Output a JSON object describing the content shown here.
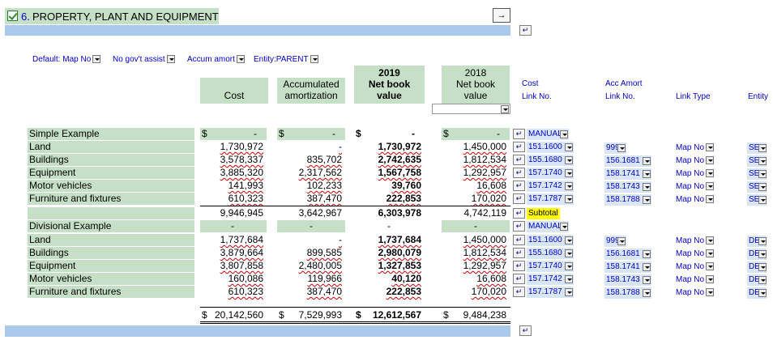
{
  "header": {
    "number": "6.",
    "title": "PROPERTY, PLANT AND EQUIPMENT"
  },
  "filters": {
    "map": "Default: Map No",
    "govt": "No gov't assist",
    "amort": "Accum amort",
    "entity": "Entity:PARENT"
  },
  "columns": {
    "cost": "Cost",
    "accum_line1": "Accumulated",
    "accum_line2": "amortization",
    "nbv2019_year": "2019",
    "nbv2019_l2": "Net book",
    "nbv2019_l3": "value",
    "nbv2018_year": "2018",
    "nbv2018_l2": "Net book",
    "nbv2018_l3": "value",
    "cost_link_1": "Cost",
    "cost_link_2": "Link No.",
    "acc_link_1": "Acc Amort",
    "acc_link_2": "Link No.",
    "link_type": "Link Type",
    "entity": "Entity"
  },
  "simple": {
    "heading": "Simple Example",
    "heading_dollars": {
      "cost": "$",
      "accum": "$",
      "nbv2019": "$",
      "nbv2018": "$"
    },
    "heading_dashes": {
      "cost": "-",
      "accum": "-",
      "nbv2019": "-",
      "nbv2018": "-"
    },
    "manual": "MANUAL",
    "rows": [
      {
        "label": "Land",
        "cost": "1,730,972",
        "accum": "-",
        "nbv2019": "1,730,972",
        "nbv2018": "1,450,000",
        "cost_link": "151.1600",
        "acc_link": "999",
        "link_type": "Map No",
        "entity": "SE"
      },
      {
        "label": "Buildings",
        "cost": "3,578,337",
        "accum": "835,702",
        "nbv2019": "2,742,635",
        "nbv2018": "1,812,534",
        "cost_link": "155.1680",
        "acc_link": "156.1681",
        "link_type": "Map No",
        "entity": "SE"
      },
      {
        "label": "Equipment",
        "cost": "3,885,320",
        "accum": "2,317,562",
        "nbv2019": "1,567,758",
        "nbv2018": "1,292,957",
        "cost_link": "157.1740",
        "acc_link": "158.1741",
        "link_type": "Map No",
        "entity": "SE"
      },
      {
        "label": "Motor vehicles",
        "cost": "141,993",
        "accum": "102,233",
        "nbv2019": "39,760",
        "nbv2018": "16,608",
        "cost_link": "157.1742",
        "acc_link": "158.1743",
        "link_type": "Map No",
        "entity": "SE"
      },
      {
        "label": "Furniture and fixtures",
        "cost": "610,323",
        "accum": "387,470",
        "nbv2019": "222,853",
        "nbv2018": "170,020",
        "cost_link": "157.1787",
        "acc_link": "158.1788",
        "link_type": "Map No",
        "entity": "SE"
      }
    ],
    "subtotal": {
      "cost": "9,946,945",
      "accum": "3,642,967",
      "nbv2019": "6,303,978",
      "nbv2018": "4,742,119",
      "tag": "Subtotal"
    }
  },
  "divisional": {
    "heading": "Divisional Example",
    "heading_dashes": {
      "cost": "-",
      "accum": "-",
      "nbv2019": "-",
      "nbv2018": "-"
    },
    "manual": "MANUAL",
    "rows": [
      {
        "label": "Land",
        "cost": "1,737,684",
        "accum": "-",
        "nbv2019": "1,737,684",
        "nbv2018": "1,450,000",
        "cost_link": "151.1600",
        "acc_link": "999",
        "link_type": "Map No",
        "entity": "DE"
      },
      {
        "label": "Buildings",
        "cost": "3,879,664",
        "accum": "899,585",
        "nbv2019": "2,980,079",
        "nbv2018": "1,812,534",
        "cost_link": "155.1680",
        "acc_link": "156.1681",
        "link_type": "Map No",
        "entity": "DE"
      },
      {
        "label": "Equipment",
        "cost": "3,807,858",
        "accum": "2,480,005",
        "nbv2019": "1,327,853",
        "nbv2018": "1,292,957",
        "cost_link": "157.1740",
        "acc_link": "158.1741",
        "link_type": "Map No",
        "entity": "DE"
      },
      {
        "label": "Motor vehicles",
        "cost": "160,086",
        "accum": "119,966",
        "nbv2019": "40,120",
        "nbv2018": "16,608",
        "cost_link": "157.1742",
        "acc_link": "158.1743",
        "link_type": "Map No",
        "entity": "DE"
      },
      {
        "label": "Furniture and fixtures",
        "cost": "610,323",
        "accum": "387,470",
        "nbv2019": "222,853",
        "nbv2018": "170,020",
        "cost_link": "157.1787",
        "acc_link": "158.1788",
        "link_type": "Map No",
        "entity": "DE"
      }
    ]
  },
  "total": {
    "dollar": "$",
    "cost": "20,142,560",
    "accum": "7,529,993",
    "nbv2019": "12,612,567",
    "nbv2018": "9,484,238"
  },
  "icons": {
    "checkbox": "checkbox-checked-icon",
    "nav": "jump-arrow-icon",
    "link": "link-icon"
  }
}
